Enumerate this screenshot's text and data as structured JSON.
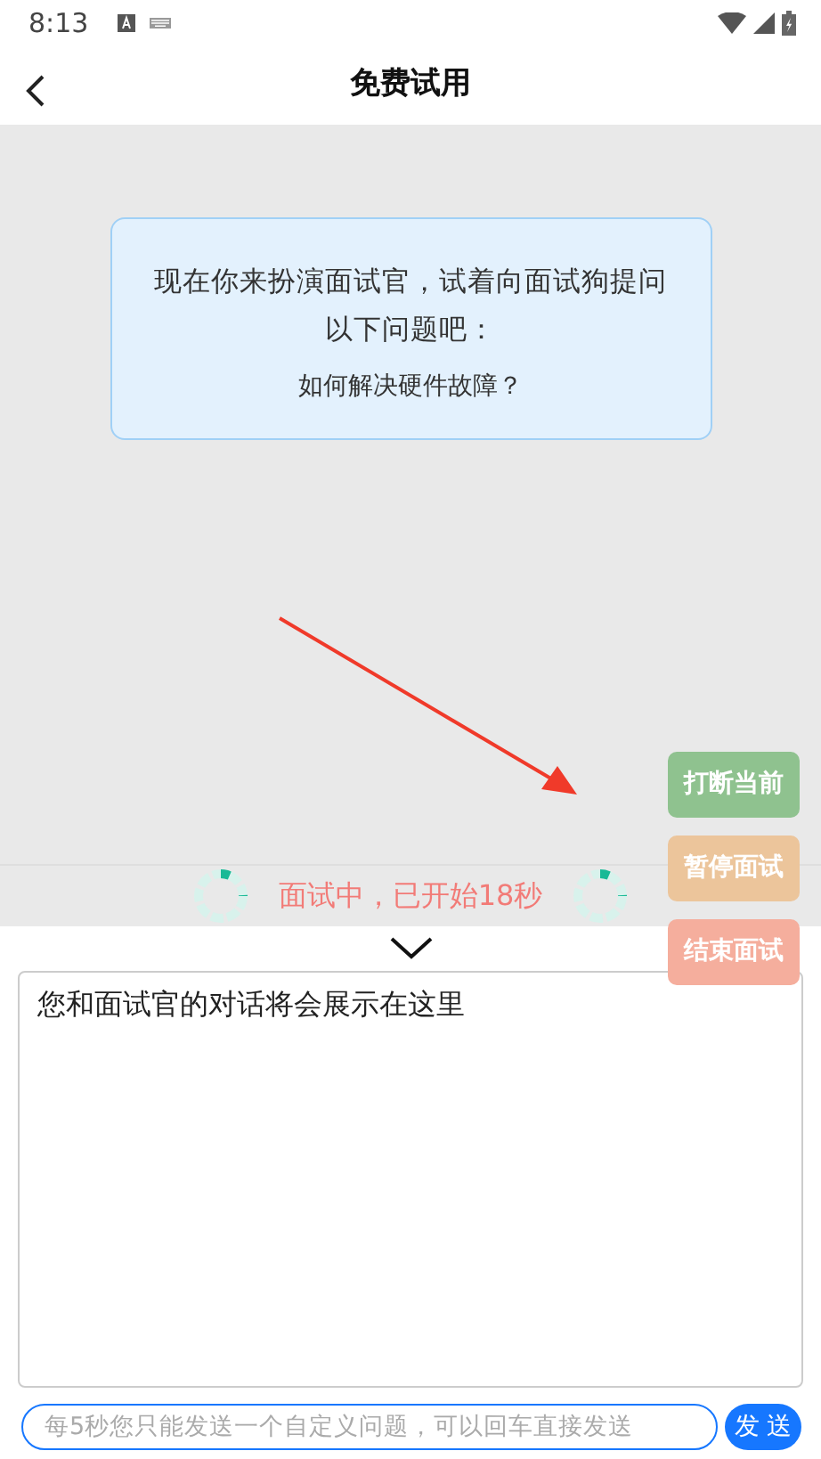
{
  "status_bar": {
    "time": "8:13"
  },
  "header": {
    "title": "免费试用"
  },
  "prompt_card": {
    "instruction": "现在你来扮演面试官，试着向面试狗提问以下问题吧：",
    "question": "如何解决硬件故障？"
  },
  "status": {
    "text": "面试中，已开始18秒"
  },
  "actions": [
    {
      "label": "打断当前",
      "color": "#8fc28f"
    },
    {
      "label": "暂停面试",
      "color": "#ecc59b"
    },
    {
      "label": "结束面试",
      "color": "#f5ae9d"
    }
  ],
  "transcript": {
    "text": "您和面试官的对话将会展示在这里"
  },
  "message_input": {
    "placeholder": "每5秒您只能发送一个自定义问题，可以回车直接发送"
  },
  "send_button": {
    "label": "发 送"
  }
}
